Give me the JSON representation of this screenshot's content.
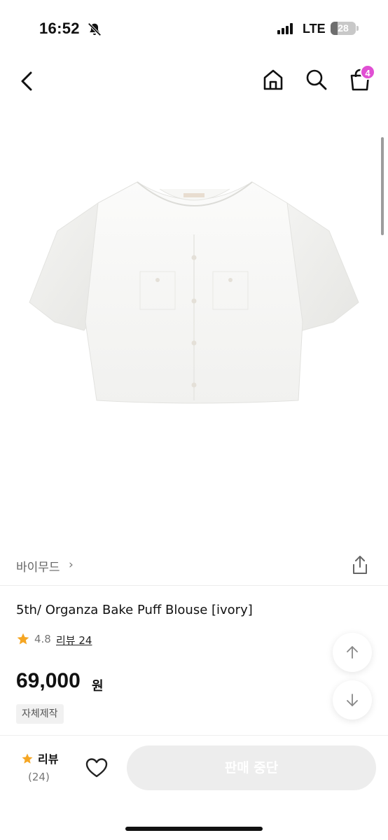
{
  "status_bar": {
    "time": "16:52",
    "network": "LTE",
    "battery": "28",
    "battery_level": 0.28
  },
  "header": {
    "cart_count": "4",
    "icons": [
      "back-icon",
      "home-icon",
      "search-icon",
      "cart-icon"
    ]
  },
  "brand": {
    "name": "바이무드",
    "chevron": "›"
  },
  "product": {
    "title": "5th/ Organza Bake Puff Blouse [ivory]",
    "rating": "4.8",
    "review_link": "리뷰 24",
    "price": "69,000",
    "price_unit": "원",
    "tag": "자체제작"
  },
  "bottom_bar": {
    "review_label": "리뷰",
    "review_count": "(24)",
    "sold_out_label": "판매 중단"
  },
  "colors": {
    "accent_badge": "#e04fd3",
    "star": "#f5a623",
    "disabled_button": "#ededed"
  }
}
